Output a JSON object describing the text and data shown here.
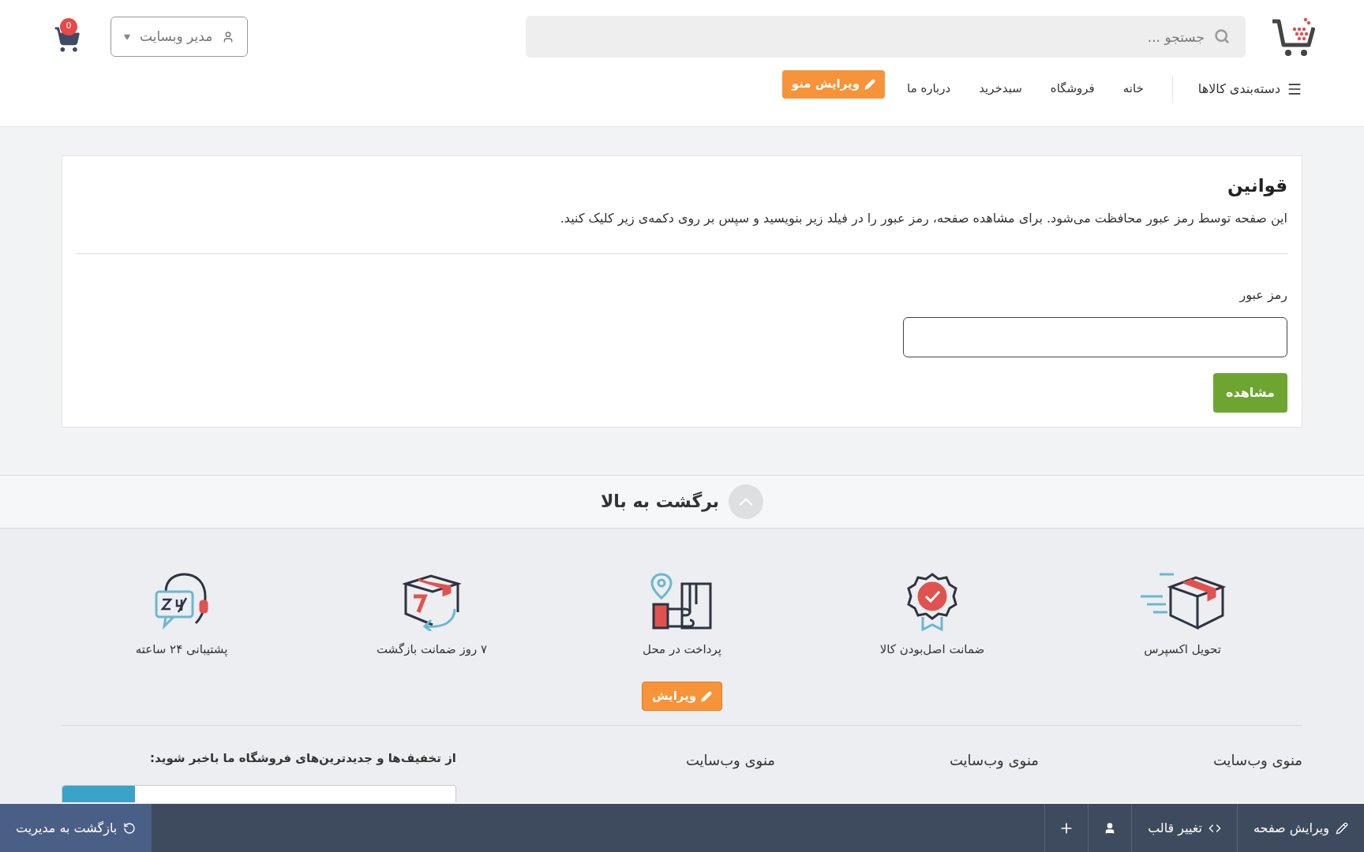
{
  "header": {
    "search": {
      "placeholder": "جستجو ..."
    },
    "user_menu": "مدیر وبسایت",
    "cart_count": "0"
  },
  "nav": {
    "categories": "دسته‌بندی کالاها",
    "links": [
      "خانه",
      "فروشگاه",
      "سبدخرید",
      "درباره ما"
    ],
    "edit_menu": "ویرایش منو"
  },
  "page": {
    "title": "قوانین",
    "description": "این صفحه توسط رمز عبور محافظت می‌شود. برای مشاهده صفحه، رمز عبور را در فیلد زیر بنویسید و سپس بر روی دکمه‌ی زیر کلیک کنید.",
    "password_label": "رمز عبور",
    "submit": "مشاهده"
  },
  "back_to_top": "برگشت به بالا",
  "features": [
    {
      "kind": "express",
      "label": "تحویل اکسپرس"
    },
    {
      "kind": "original",
      "label": "ضمانت اصل‌بودن کالا"
    },
    {
      "kind": "cod",
      "label": "پرداخت در محل"
    },
    {
      "kind": "return",
      "label": "۷ روز ضمانت بازگشت"
    },
    {
      "kind": "support",
      "label": "پشتیبانی ۲۴ ساعته"
    }
  ],
  "edit_button": "ویرایش",
  "footer": {
    "columns": [
      "منوی وب‌سایت",
      "منوی وب‌سایت",
      "منوی وب‌سایت"
    ],
    "newsletter": "از تخفیف‌ها و جدیدترین‌های فروشگاه ما باخبر شوید:"
  },
  "admin_bar": {
    "edit_page": "ویرایش صفحه",
    "change_template": "تغییر قالب",
    "back": "بازگشت به مدیریت"
  }
}
